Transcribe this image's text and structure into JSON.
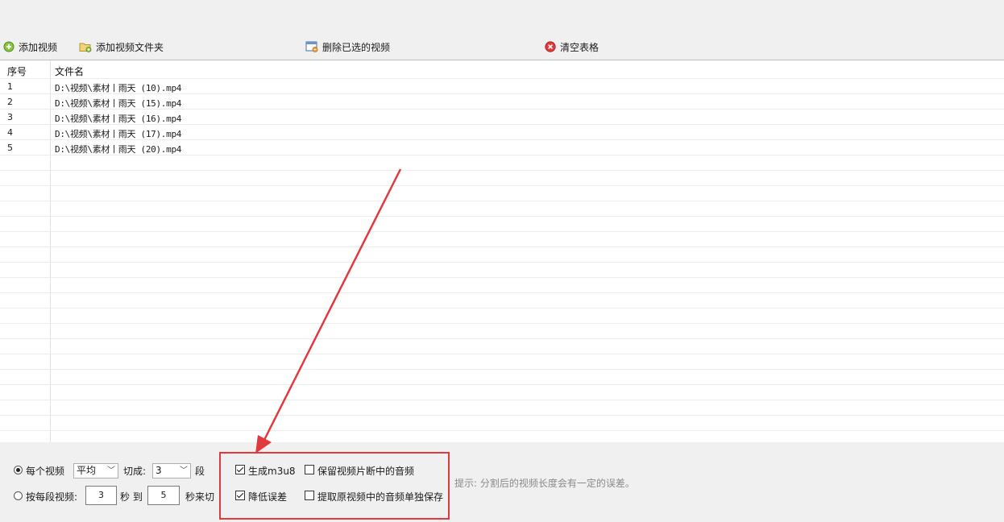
{
  "toolbar": {
    "add_video": "添加视频",
    "add_folder": "添加视频文件夹",
    "delete_selected": "删除已选的视频",
    "clear_table": "清空表格"
  },
  "table": {
    "col_index": "序号",
    "col_filename": "文件名",
    "rows": [
      {
        "index": "1",
        "filename": "D:\\视频\\素材丨雨天 (10).mp4"
      },
      {
        "index": "2",
        "filename": "D:\\视频\\素材丨雨天 (15).mp4"
      },
      {
        "index": "3",
        "filename": "D:\\视频\\素材丨雨天 (16).mp4"
      },
      {
        "index": "4",
        "filename": "D:\\视频\\素材丨雨天 (17).mp4"
      },
      {
        "index": "5",
        "filename": "D:\\视频\\素材丨雨天 (20).mp4"
      }
    ]
  },
  "options": {
    "mode_each_label": "每个视频",
    "mode_each_selected": true,
    "split_method": "平均",
    "cut_into_label": "切成:",
    "segments": "3",
    "segments_unit": "段",
    "mode_per_segment_label": "按每段视频:",
    "mode_per_segment_selected": false,
    "from_seconds": "3",
    "seconds_to_label": "秒 到",
    "to_seconds": "5",
    "seconds_cut_label": "秒来切",
    "gen_m3u8_label": "生成m3u8",
    "gen_m3u8_checked": true,
    "keep_audio_label": "保留视频片断中的音频",
    "keep_audio_checked": false,
    "reduce_error_label": "降低误差",
    "reduce_error_checked": true,
    "extract_audio_label": "提取原视频中的音频单独保存",
    "extract_audio_checked": false,
    "hint": "提示: 分割后的视频长度会有一定的误差。"
  },
  "colors": {
    "annotation_red": "#e0393e"
  }
}
